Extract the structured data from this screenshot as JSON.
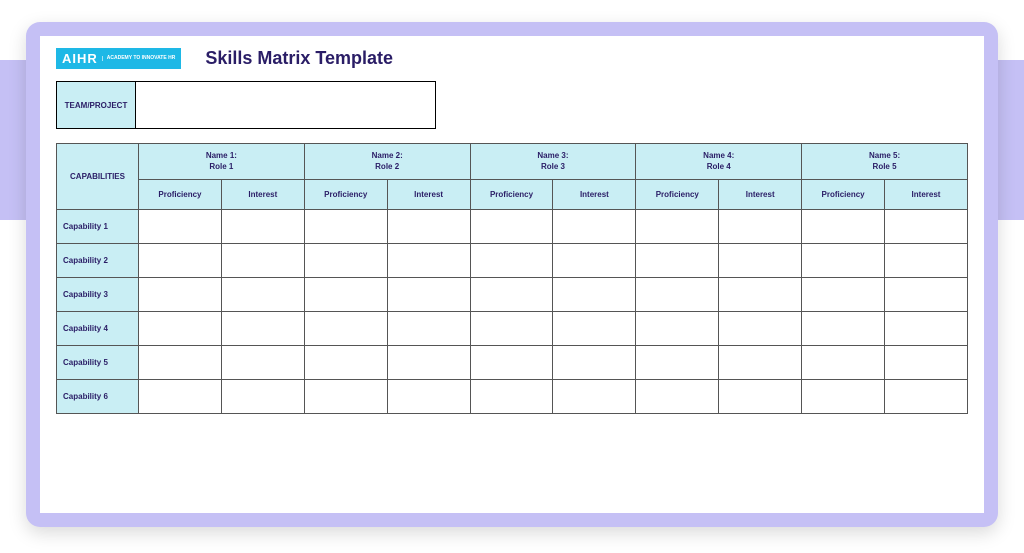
{
  "logo": {
    "brand": "AIHR",
    "tagline": "ACADEMY TO INNOVATE HR"
  },
  "title": "Skills Matrix Template",
  "team_project_label": "TEAM/PROJECT",
  "team_project_value": "",
  "capabilities_header": "CAPABILITIES",
  "sub_headers": {
    "proficiency": "Proficiency",
    "interest": "Interest"
  },
  "people": [
    {
      "name": "Name 1:",
      "role": "Role 1"
    },
    {
      "name": "Name 2:",
      "role": "Role 2"
    },
    {
      "name": "Name 3:",
      "role": "Role 3"
    },
    {
      "name": "Name 4:",
      "role": "Role 4"
    },
    {
      "name": "Name 5:",
      "role": "Role 5"
    }
  ],
  "capabilities": [
    "Capability 1",
    "Capability 2",
    "Capability 3",
    "Capability 4",
    "Capability 5",
    "Capability 6"
  ],
  "colors": {
    "accent_bg": "#c9eef4",
    "title": "#2a1d66",
    "frame": "#c5c0f5",
    "logo_bg": "#1eb8e6"
  }
}
